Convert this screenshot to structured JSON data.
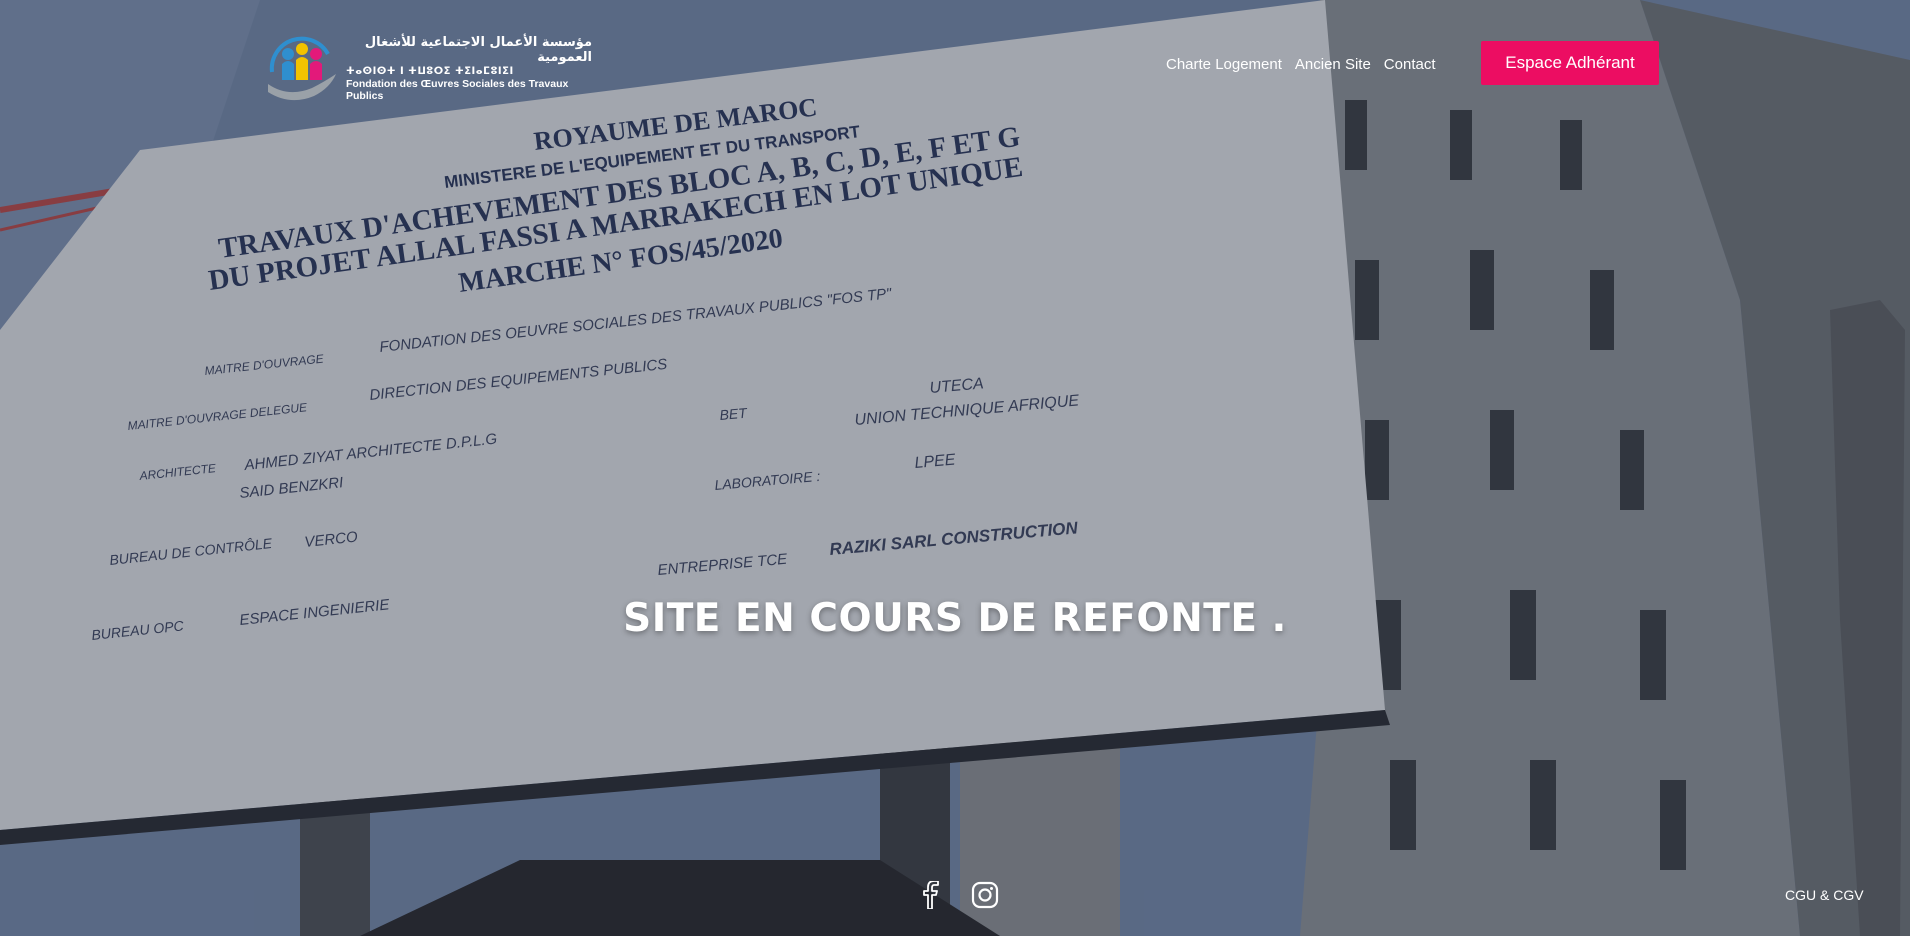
{
  "logo": {
    "arabic": "مؤسسة الأعمال الاجتماعية للأشغال العمومية",
    "tifinagh": "ⵜⴰⵙⵏⵙⵜ ⵏ ⵜⵡⵓⵔⵉ ⵜⵉⵏⴰⵎⵓⵏⵉⵏ",
    "french": "Fondation des Œuvres Sociales des Travaux Publics"
  },
  "nav": {
    "items": [
      "Charte Logement",
      "Ancien Site",
      "Contact"
    ]
  },
  "cta": {
    "label": "Espace Adhérant"
  },
  "hero": {
    "headline": "SITE EN COURS DE REFONTE .",
    "sign": {
      "line1": "ROYAUME DE MAROC",
      "line2": "MINISTERE DE L'EQUIPEMENT ET DU TRANSPORT",
      "line3": "TRAVAUX D'ACHEVEMENT DES BLOC A, B, C, D, E, F ET G",
      "line4": "DU PROJET ALLAL FASSI A MARRAKECH EN LOT UNIQUE",
      "line5": "MARCHE N° FOS/45/2020",
      "row1_label": "MAITRE D'OUVRAGE",
      "row1_value": "FONDATION DES OEUVRE SOCIALES DES TRAVAUX PUBLICS \"FOS TP\"",
      "row2_label": "MAITRE D'OUVRAGE DELEGUE",
      "row2_value": "DIRECTION DES EQUIPEMENTS PUBLICS",
      "row3_label": "ARCHITECTE",
      "row3_value": "AHMED ZIYAT ARCHITECTE D.P.L.G",
      "row3_value2": "SAID BENZKRI",
      "row4_label": "BUREAU DE CONTRÔLE",
      "row4_value": "VERCO",
      "row5_label": "BUREAU OPC",
      "row5_value": "ESPACE INGENIERIE",
      "bet_label": "BET",
      "bet_value1": "UTECA",
      "bet_value2": "UNION TECHNIQUE AFRIQUE",
      "lab_label": "LABORATOIRE :",
      "lab_value": "LPEE",
      "ent_label": "ENTREPRISE  TCE",
      "ent_value": "RAZIKI SARL CONSTRUCTION"
    }
  },
  "footer": {
    "social": [
      "facebook-icon",
      "instagram-icon"
    ],
    "legal_link": "CGU & CGV"
  },
  "colors": {
    "accent": "#ec0d62",
    "text": "#ffffff"
  }
}
